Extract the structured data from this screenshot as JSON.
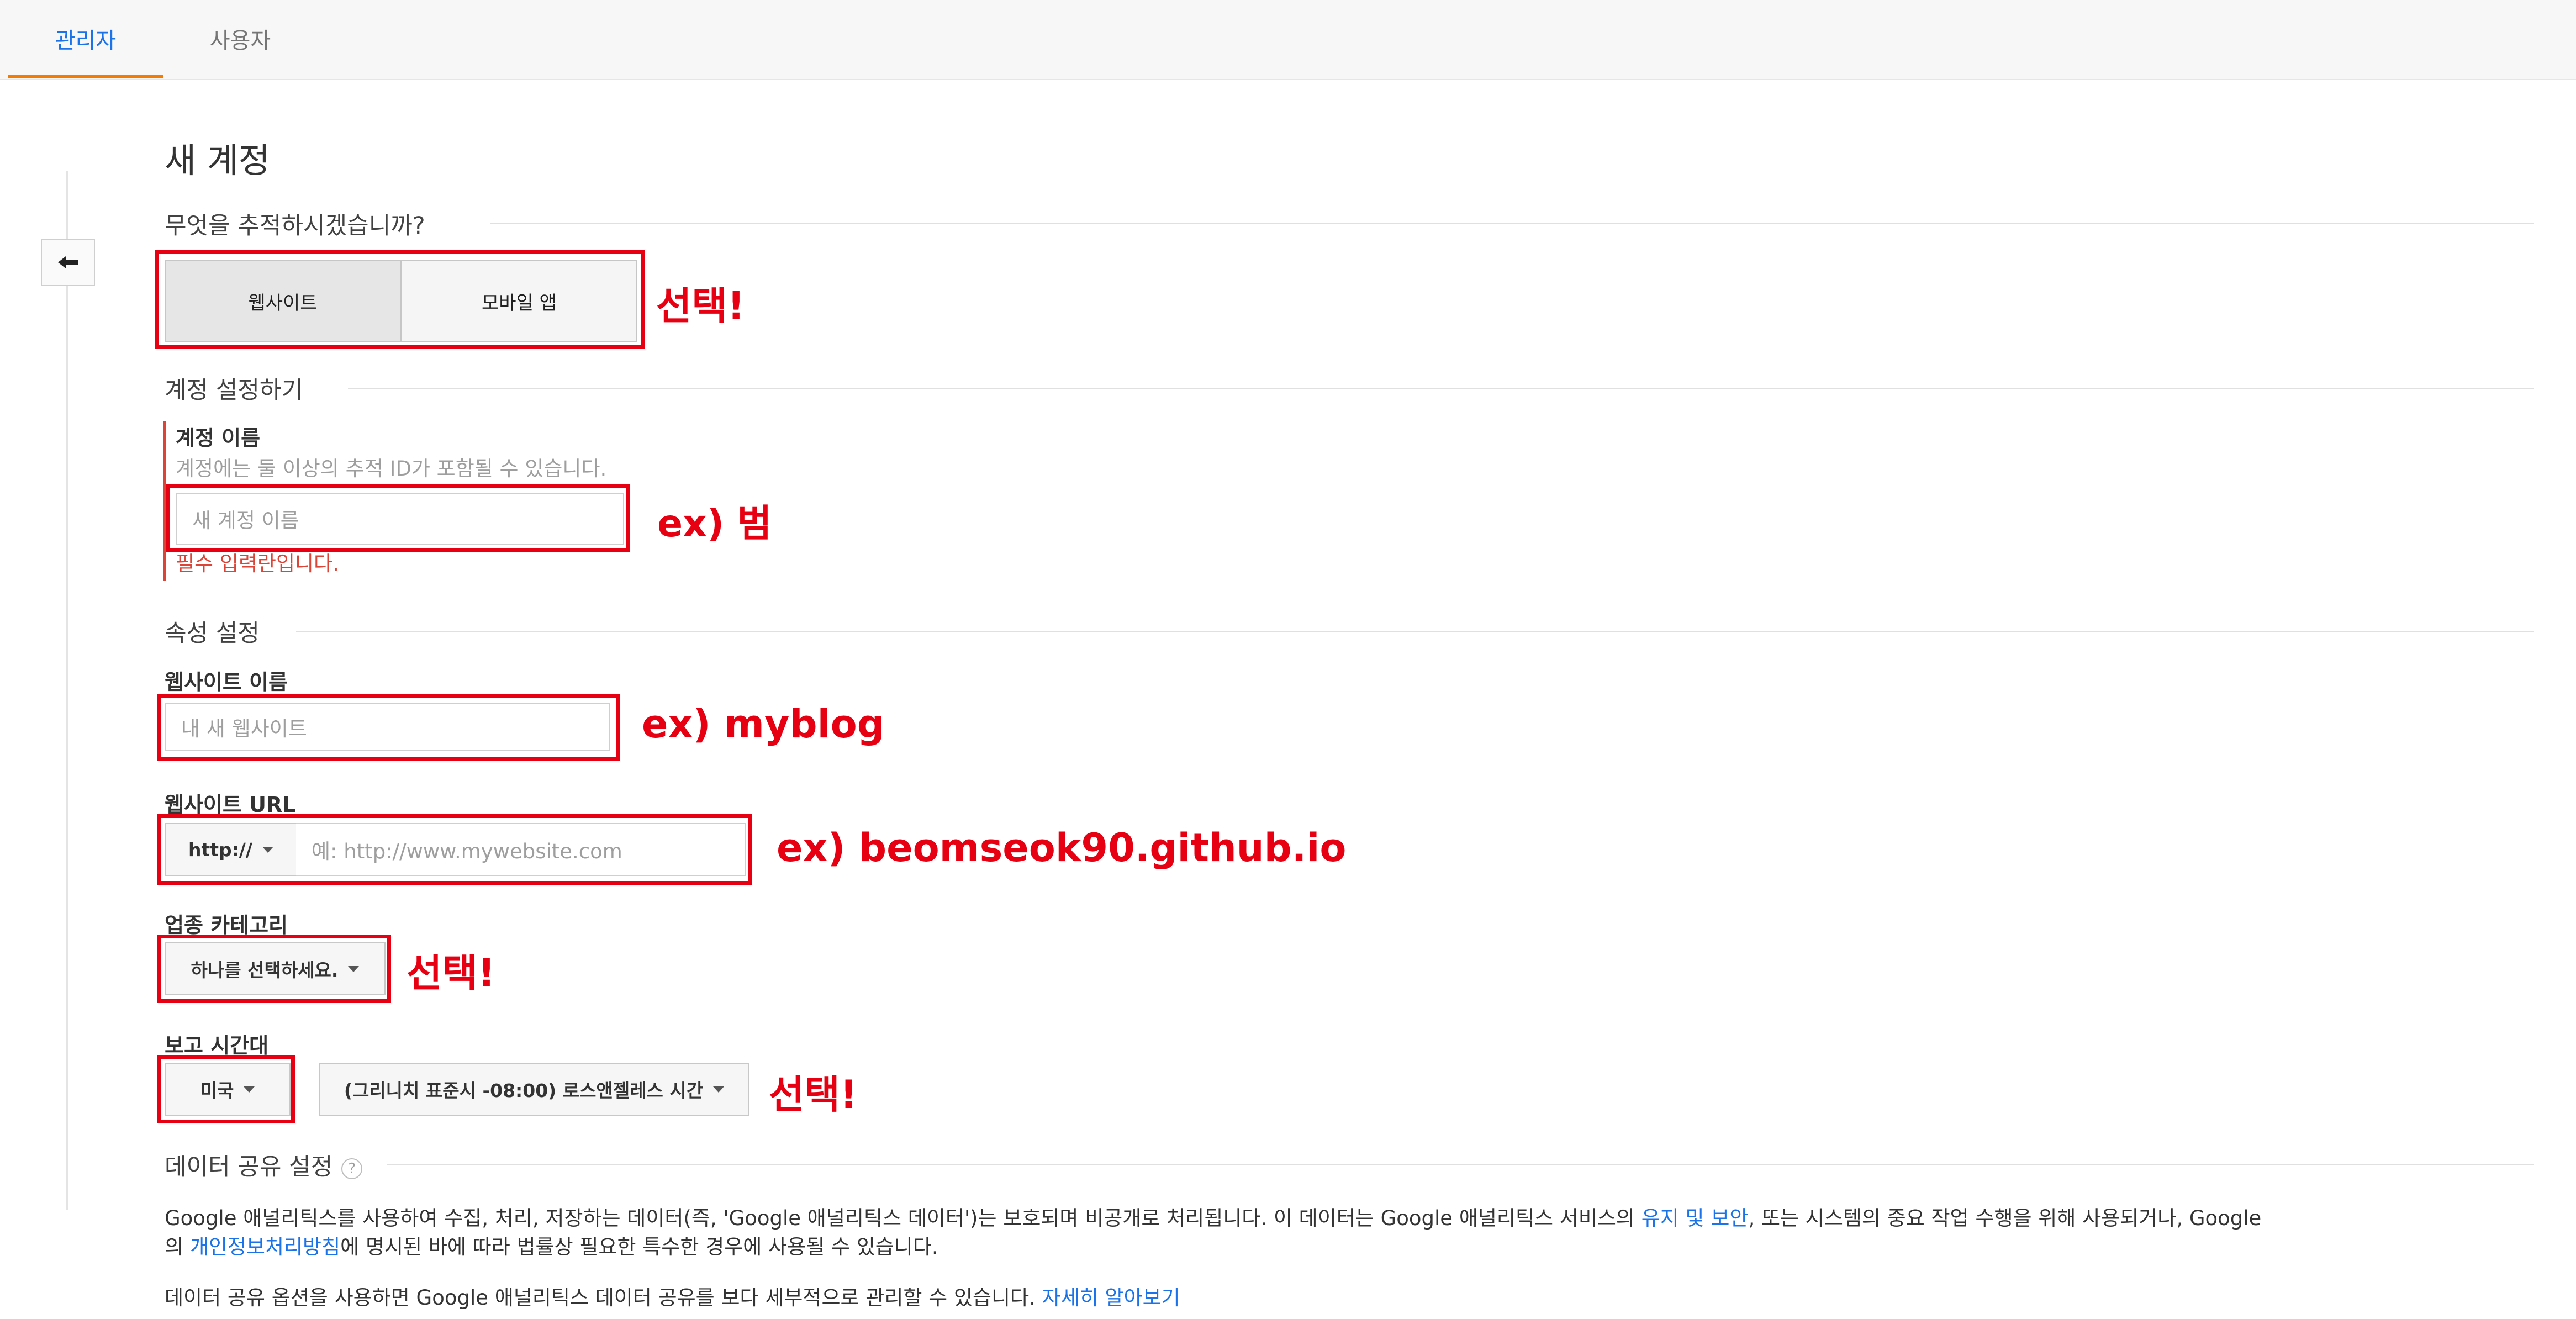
{
  "tabs": {
    "admin": "관리자",
    "user": "사용자"
  },
  "page": {
    "title": "새 계정"
  },
  "track": {
    "section": "무엇을 추적하시겠습니까?",
    "website": "웹사이트",
    "mobile": "모바일 앱"
  },
  "account": {
    "section": "계정 설정하기",
    "name_label": "계정 이름",
    "name_help": "계정에는 둘 이상의 추적 ID가 포함될 수 있습니다.",
    "name_placeholder": "새 계정 이름",
    "name_error": "필수 입력란입니다."
  },
  "property": {
    "section": "속성 설정",
    "site_name_label": "웹사이트 이름",
    "site_name_placeholder": "내 새 웹사이트",
    "url_label": "웹사이트 URL",
    "protocol": "http://",
    "url_placeholder": "예: http://www.mywebsite.com",
    "category_label": "업종 카테고리",
    "category_value": "하나를 선택하세요.",
    "tz_label": "보고 시간대",
    "country_value": "미국",
    "tz_value": "(그리니치 표준시 -08:00) 로스앤젤레스 시간"
  },
  "sharing": {
    "section": "데이터 공유 설정",
    "help_icon": "question-mark-icon",
    "p1_a": "Google 애널리틱스를 사용하여 수집, 처리, 저장하는 데이터(즉, 'Google 애널리틱스 데이터')는 보호되며 비공개로 처리됩니다. 이 데이터는 Google 애널리틱스 서비스의 ",
    "p1_link1": "유지 및 보안",
    "p1_b": ", 또는 시스템의 중요 작업 수행을 위해 사용되거나, Google",
    "p1_c": "의 ",
    "p1_link2": "개인정보처리방침",
    "p1_d": "에 명시된 바에 따라 법률상 필요한 특수한 경우에 사용될 수 있습니다.",
    "p2_a": "데이터 공유 옵션을 사용하면 Google 애널리틱스 데이터 공유를 보다 세부적으로 관리할 수 있습니다. ",
    "p2_link": "자세히 알아보기"
  },
  "annotations": {
    "select1": "선택!",
    "account_ex": "ex) 범",
    "site_ex": "ex) myblog",
    "url_ex": "ex) beomseok90.github.io",
    "select2": "선택!",
    "select3": "선택!"
  },
  "colors": {
    "annotation_red": "#e60012",
    "link_blue": "#1a73e8",
    "tab_underline": "#f57c00",
    "error_red": "#db4437"
  }
}
